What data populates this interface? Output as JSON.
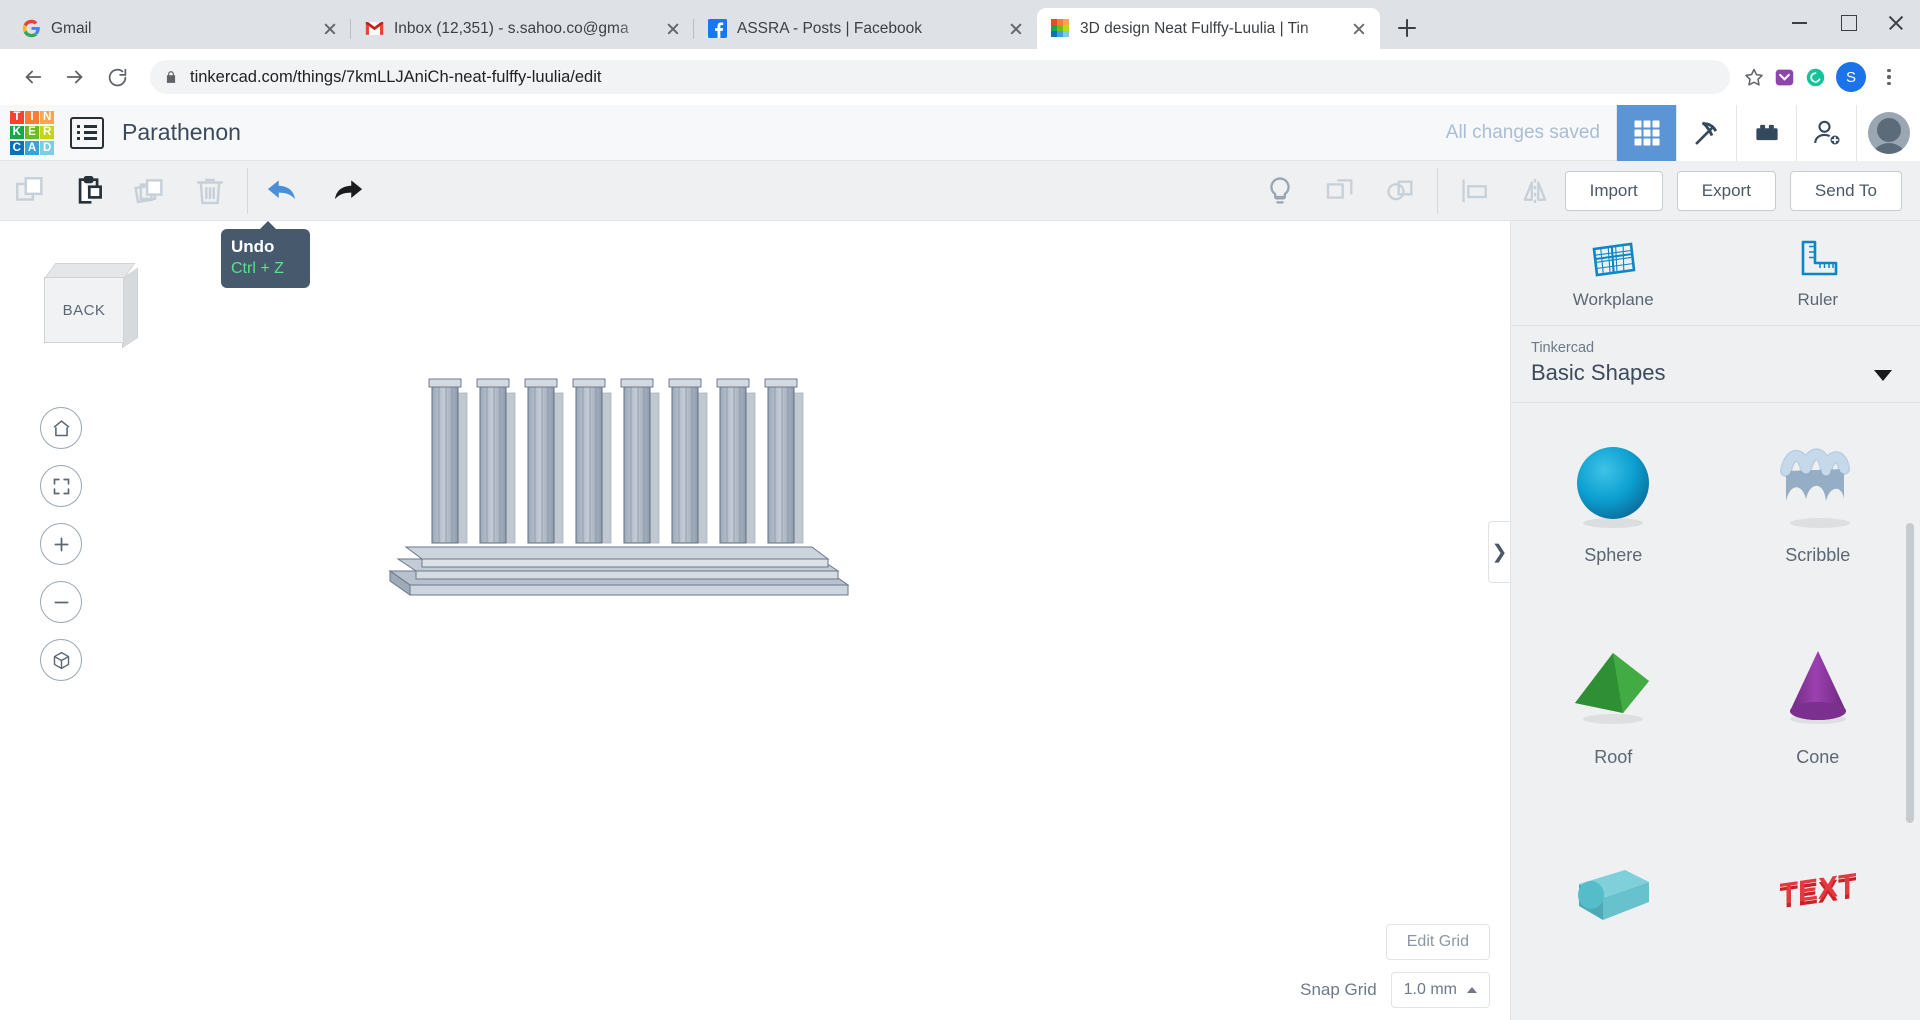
{
  "browser": {
    "tabs": [
      {
        "title": "Gmail",
        "favicon": "gmail-g-icon",
        "active": false
      },
      {
        "title": "Inbox (12,351) - s.sahoo.co@gma",
        "favicon": "gmail-m-icon",
        "active": false
      },
      {
        "title": "ASSRA - Posts | Facebook",
        "favicon": "facebook-icon",
        "active": false
      },
      {
        "title": "3D design Neat Fulffy-Luulia | Tin",
        "favicon": "tinkercad-icon",
        "active": true
      }
    ],
    "new_tab_label": "+",
    "url": "tinkercad.com/things/7kmLLJAniCh-neat-fulffy-luulia/edit",
    "profile_initial": "S",
    "window_controls": [
      "minimize",
      "maximize",
      "close"
    ]
  },
  "app_header": {
    "logo_tiles": [
      {
        "letter": "T",
        "color": "#f4442e"
      },
      {
        "letter": "I",
        "color": "#f97c37"
      },
      {
        "letter": "N",
        "color": "#fca44a"
      },
      {
        "letter": "K",
        "color": "#17a84a"
      },
      {
        "letter": "E",
        "color": "#6cbd1e"
      },
      {
        "letter": "R",
        "color": "#c2d617"
      },
      {
        "letter": "C",
        "color": "#0b72b5"
      },
      {
        "letter": "A",
        "color": "#3ba3d8"
      },
      {
        "letter": "D",
        "color": "#7ecbe8"
      }
    ],
    "title": "Parathenon",
    "save_status": "All changes saved",
    "icons": [
      {
        "name": "blocks-grid-icon",
        "active": true
      },
      {
        "name": "minecraft-pickaxe-icon",
        "active": false
      },
      {
        "name": "lego-brick-icon",
        "active": false
      },
      {
        "name": "invite-person-icon",
        "active": false
      }
    ],
    "avatar": "user-avatar"
  },
  "edit_toolbar": {
    "left_buttons": [
      {
        "name": "copy-button",
        "enabled": false
      },
      {
        "name": "paste-button",
        "enabled": true
      },
      {
        "name": "duplicate-button",
        "enabled": false
      },
      {
        "name": "delete-button",
        "enabled": false
      },
      {
        "name": "undo-button",
        "enabled": true
      },
      {
        "name": "redo-button",
        "enabled": true
      }
    ],
    "right_buttons": [
      {
        "name": "lightbulb-button",
        "enabled": true
      },
      {
        "name": "group-button",
        "enabled": false
      },
      {
        "name": "ungroup-button",
        "enabled": false
      },
      {
        "name": "align-button",
        "enabled": false
      },
      {
        "name": "mirror-button",
        "enabled": false
      }
    ],
    "import_label": "Import",
    "export_label": "Export",
    "send_to_label": "Send To"
  },
  "tooltip": {
    "title": "Undo",
    "shortcut": "Ctrl + Z"
  },
  "canvas": {
    "view_cube_label": "BACK",
    "nav_buttons": [
      {
        "name": "home-view-button"
      },
      {
        "name": "fit-to-view-button"
      },
      {
        "name": "zoom-in-button"
      },
      {
        "name": "zoom-out-button"
      },
      {
        "name": "orthographic-view-button"
      }
    ],
    "edit_grid_label": "Edit Grid",
    "snap_grid_label": "Snap Grid",
    "snap_grid_value": "1.0 mm",
    "panel_toggle_label": "❯"
  },
  "right_panel": {
    "tools": [
      {
        "label": "Workplane",
        "icon": "workplane-icon"
      },
      {
        "label": "Ruler",
        "icon": "ruler-icon"
      }
    ],
    "library_source": "Tinkercad",
    "library_name": "Basic Shapes",
    "shapes": [
      {
        "label": "Sphere",
        "icon": "sphere-shape",
        "color": "#0b9fd0"
      },
      {
        "label": "Scribble",
        "icon": "scribble-shape",
        "color": "#9bb9d4"
      },
      {
        "label": "Roof",
        "icon": "roof-shape",
        "color": "#3aa63a"
      },
      {
        "label": "Cone",
        "icon": "cone-shape",
        "color": "#8e3ba0"
      },
      {
        "label": "",
        "icon": "tube-shape",
        "color": "#55bcc9"
      },
      {
        "label": "",
        "icon": "text-shape",
        "color": "#cc2027"
      }
    ]
  },
  "colors": {
    "accent_blue": "#5b95d6",
    "tool_blue": "#0b86c8",
    "tooltip_bg": "#47596c",
    "tooltip_key": "#5ce08a"
  }
}
